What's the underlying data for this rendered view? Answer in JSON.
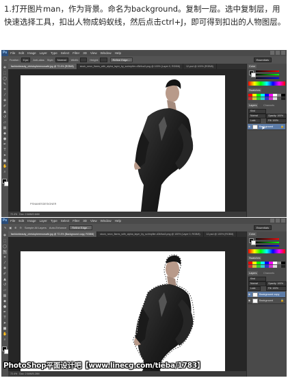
{
  "instructions": {
    "text": "1.打开图片man，作为背景。命名为background。复制一层。选中复制层，用快速选择工具，扣出人物成蚂蚁线，然后点击ctrl+J，即可得到扣出的人物图层。"
  },
  "menu": {
    "logo": "Ps",
    "items": [
      "File",
      "Edit",
      "Image",
      "Layer",
      "Type",
      "Select",
      "Filter",
      "3D",
      "View",
      "Window",
      "Help"
    ]
  },
  "screen1": {
    "options": {
      "feather_label": "Feather:",
      "feather_value": "0 px",
      "antialias_label": "Anti-alias",
      "style_label": "Style:",
      "style_value": "Normal",
      "width_label": "Width:",
      "height_label": "Height:",
      "refine_button": "Refine Edge...",
      "workspace": "Essentials"
    },
    "tabs": [
      "fashionbeauty_christophermoosafd.jpg @ 72.4% (RGB/8)",
      "stock_neon_flares_with_alpha_layer_by_scrimpfier-d3k9ca3.png @ 100% (Layer 0, RGB/8)",
      "12.psd @ 100% (RGB/8)"
    ],
    "status": "Doc: 2.64M/2.64M",
    "zoom": "72.4%",
    "doc_logo": "PSNAMESDESIGNER",
    "panels": {
      "color_tab": "Color",
      "swatches_tab": "Swatches",
      "layers_tab": "Layers",
      "channels_tab": "Channels",
      "kind": "Kind",
      "blend_mode": "Normal",
      "opacity": "Opacity: 100%",
      "lock": "Lock:",
      "fill": "Fill: 100%",
      "layers": [
        {
          "name": "Background",
          "selected": true
        }
      ]
    }
  },
  "screen2": {
    "options": {
      "sample_all": "Sample All Layers",
      "auto_enhance": "Auto-Enhance",
      "refine_button": "Refine Edge...",
      "workspace": "Essentials"
    },
    "tabs": [
      "fashionbeauty_christophermoosafd.jpg @ 72.4% (Background copy, RGB/8)",
      "stock_neon_flares_with_alpha_layer_by_scrimpfier-d3k9ca3.png @ 100% (Layer 0, RGB/8)",
      "12.psd @ 100% (RGB/8)"
    ],
    "status": "Doc: 2.64M/5.28M",
    "zoom": "72.4%",
    "panels": {
      "color_tab": "Color",
      "swatches_tab": "Swatches",
      "layers_tab": "Layers",
      "channels_tab": "Channels",
      "kind": "Kind",
      "blend_mode": "Normal",
      "opacity": "Opacity: 100%",
      "lock": "Lock:",
      "fill": "Fill: 100%",
      "layers": [
        {
          "name": "Background copy",
          "selected": true
        },
        {
          "name": "Background",
          "selected": false
        }
      ]
    }
  },
  "watermark": {
    "text": "PhotoShop平面设计吧【www.linecg.com/tieba/1783】"
  },
  "colors": {
    "ps_bg": "#3c3c3c",
    "panel_bg": "#4a4a4a",
    "layer_selected": "#5d7ca8",
    "canvas_bg": "#ffffff"
  },
  "icons": [
    "move-tool-icon",
    "marquee-tool-icon",
    "lasso-tool-icon",
    "quick-selection-tool-icon",
    "crop-tool-icon",
    "eyedropper-tool-icon",
    "brush-tool-icon",
    "eraser-tool-icon",
    "type-tool-icon",
    "hand-tool-icon",
    "zoom-tool-icon",
    "eye-icon",
    "lock-icon"
  ]
}
